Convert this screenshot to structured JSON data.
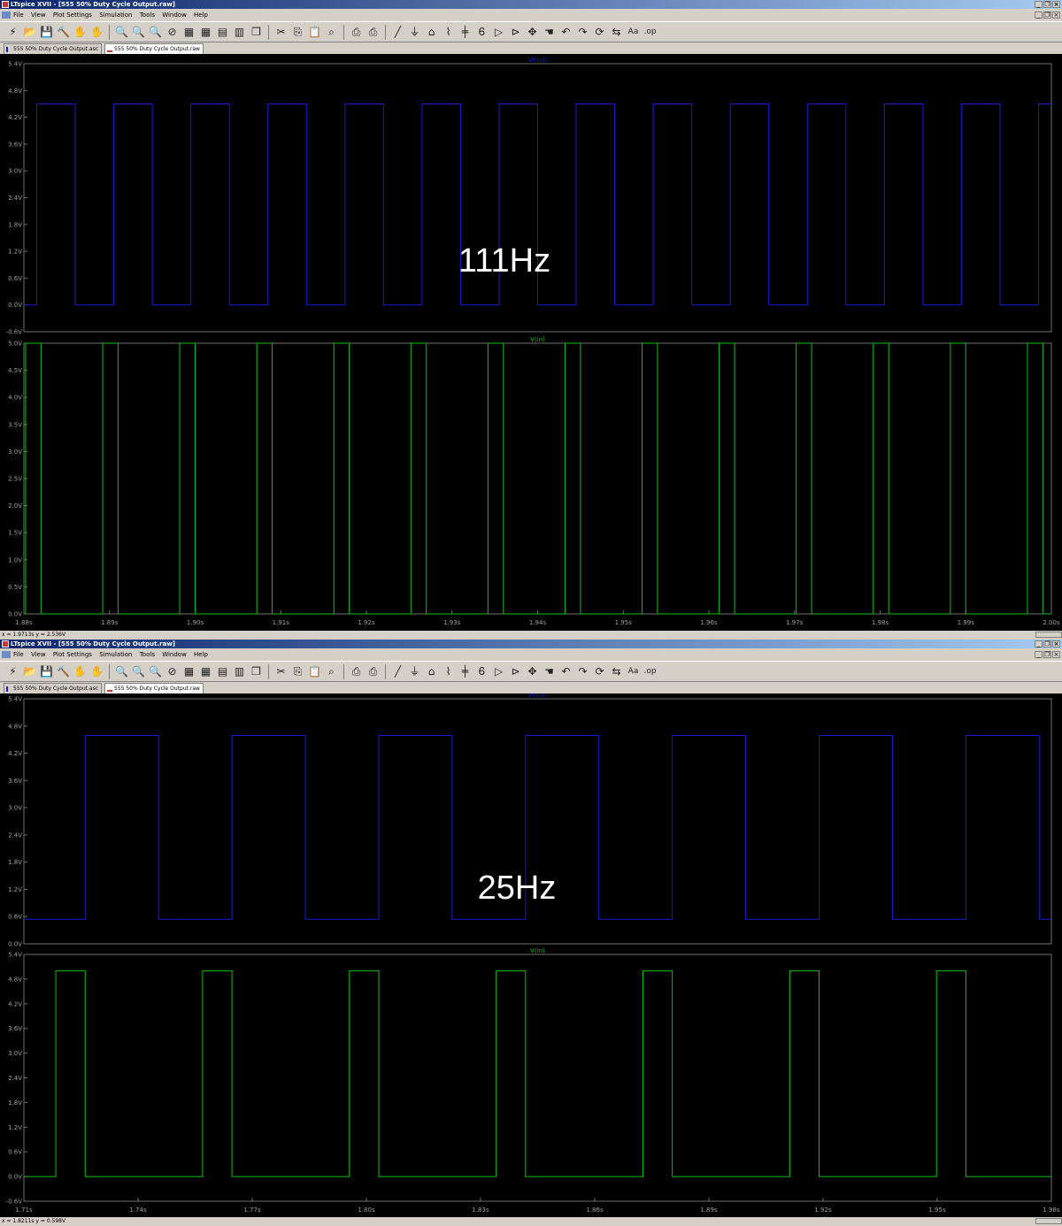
{
  "windows": [
    {
      "title": "LTspice XVII - [555 50% Duty Cycle Output.raw]",
      "menu": [
        "File",
        "View",
        "Plot Settings",
        "Simulation",
        "Tools",
        "Window",
        "Help"
      ],
      "tabs": [
        "555 50% Duty Cycle Output.asc",
        "555 50% Duty Cycle Output.raw"
      ],
      "frequency_label": "111Hz",
      "status": "x = 1.9713s   y = 2.536V",
      "controls": {
        "minimize": "_",
        "restore": "❐",
        "close": "×"
      }
    },
    {
      "title": "LTspice XVII - [555 50% Duty Cycle Output.raw]",
      "menu": [
        "File",
        "View",
        "Plot Settings",
        "Simulation",
        "Tools",
        "Window",
        "Help"
      ],
      "tabs": [
        "555 50% Duty Cycle Output.asc",
        "555 50% Duty Cycle Output.raw"
      ],
      "frequency_label": "25Hz",
      "status": "x = 1.8211s   y = 0.598V",
      "controls": {
        "minimize": "_",
        "restore": "❐",
        "close": "×"
      }
    }
  ],
  "toolbar_icons": [
    "run-icon",
    "open-icon",
    "save-icon",
    "control-panel-icon",
    "halt-icon",
    "pan-icon",
    "zoom-in-icon",
    "zoom-out-icon",
    "zoom-back-icon",
    "zoom-fit-icon",
    "autorange-icon",
    "grid-icon",
    "tile-horizontal-icon",
    "tile-vertical-icon",
    "cascade-icon",
    "cut-icon",
    "copy-icon",
    "paste-icon",
    "find-icon",
    "print-icon",
    "print-preview-icon",
    "wire-icon",
    "ground-icon",
    "label-icon",
    "resistor-icon",
    "capacitor-icon",
    "inductor-icon",
    "diode-icon",
    "component-icon",
    "move-icon",
    "drag-icon",
    "undo-icon",
    "redo-icon",
    "rotate-icon",
    "mirror-icon",
    "text-icon",
    "spice-directive-icon"
  ],
  "colors": {
    "vout": "#1a1ad8",
    "vin": "#10c010",
    "background": "#000000",
    "grid": "#3a3a3a"
  },
  "chart_data": [
    {
      "type": "line",
      "title": "V(out)",
      "series": [
        {
          "name": "V(out)",
          "color": "#1a1ad8",
          "low": 0.0,
          "high": 4.5,
          "period_s": 0.009,
          "high_time_s": 0.0045,
          "first_rise_s": 1.8815
        }
      ],
      "x": {
        "min": 1.88,
        "max": 2.0
      },
      "ylim": [
        -0.6,
        5.4
      ],
      "yticks": [
        "5.4V",
        "4.8V",
        "4.2V",
        "3.6V",
        "3.0V",
        "2.4V",
        "1.8V",
        "1.2V",
        "0.6V",
        "0.0V",
        "-0.6V"
      ],
      "xticks": [],
      "annotation": "111Hz"
    },
    {
      "type": "line",
      "title": "V(in)",
      "series": [
        {
          "name": "V(in)",
          "color": "#10c010",
          "low": 0.0,
          "high": 5.0,
          "period_s": 0.009,
          "high_time_s": 0.0018,
          "first_rise_s": 1.8802
        }
      ],
      "x": {
        "min": 1.88,
        "max": 2.0
      },
      "ylim": [
        0.0,
        5.0
      ],
      "yticks": [
        "5.0V",
        "4.5V",
        "4.0V",
        "3.5V",
        "3.0V",
        "2.5V",
        "2.0V",
        "1.5V",
        "1.0V",
        "0.5V",
        "0.0V"
      ],
      "xticks": [
        "1.88s",
        "1.89s",
        "1.90s",
        "1.91s",
        "1.92s",
        "1.93s",
        "1.94s",
        "1.95s",
        "1.96s",
        "1.97s",
        "1.98s",
        "1.99s",
        "2.00s"
      ]
    },
    {
      "type": "line",
      "title": "V(out)",
      "series": [
        {
          "name": "V(out)",
          "color": "#1a1ad8",
          "low": 0.0,
          "high": 4.5,
          "period_s": 0.04,
          "high_time_s": 0.02,
          "first_rise_s": 1.7267
        }
      ],
      "x": {
        "min": 1.71,
        "max": 1.99
      },
      "ylim": [
        -0.6,
        5.4
      ],
      "yticks": [
        "5.4V",
        "4.8V",
        "4.2V",
        "3.6V",
        "3.0V",
        "2.4V",
        "1.8V",
        "1.2V",
        "0.6V",
        "0.0V"
      ],
      "xticks": [],
      "annotation": "25Hz"
    },
    {
      "type": "line",
      "title": "V(in)",
      "series": [
        {
          "name": "V(in)",
          "color": "#10c010",
          "low": 0.0,
          "high": 5.0,
          "period_s": 0.04,
          "high_time_s": 0.008,
          "first_rise_s": 1.7187
        }
      ],
      "x": {
        "min": 1.71,
        "max": 1.99
      },
      "ylim": [
        -0.6,
        5.4
      ],
      "yticks": [
        "5.4V",
        "4.8V",
        "4.2V",
        "3.6V",
        "3.0V",
        "2.4V",
        "1.8V",
        "1.2V",
        "0.6V",
        "0.0V",
        "-0.6V"
      ],
      "xticks": [
        "1.71s",
        "1.74s",
        "1.77s",
        "1.80s",
        "1.83s",
        "1.86s",
        "1.89s",
        "1.92s",
        "1.95s",
        "1.98s"
      ]
    }
  ]
}
